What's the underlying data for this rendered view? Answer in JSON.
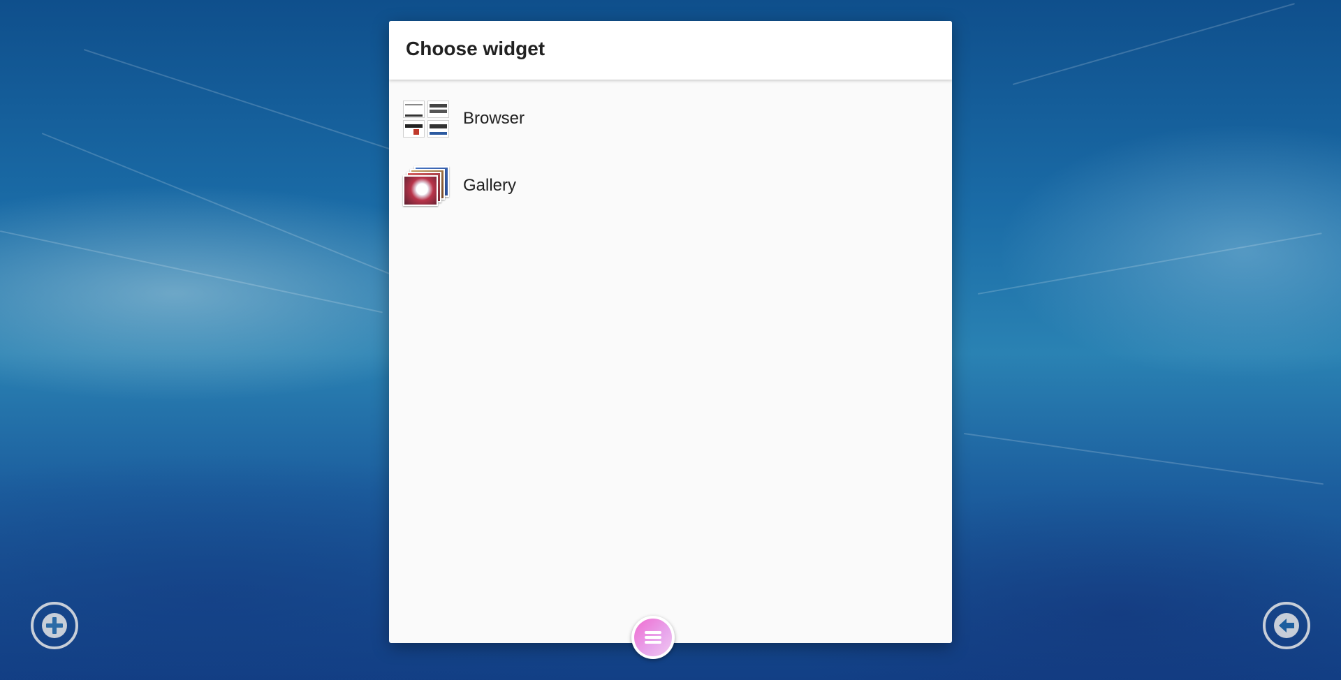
{
  "dialog": {
    "title": "Choose widget",
    "items": [
      {
        "label": "Browser",
        "icon": "browser-thumbnail-icon"
      },
      {
        "label": "Gallery",
        "icon": "gallery-thumbnail-icon"
      }
    ]
  },
  "controls": {
    "menu_fab_icon": "menu-icon",
    "add_icon": "plus-icon",
    "back_icon": "arrow-left-icon"
  },
  "colors": {
    "fab_accent": "#f06bd0",
    "dialog_background": "#fafafa",
    "header_background": "#ffffff"
  }
}
